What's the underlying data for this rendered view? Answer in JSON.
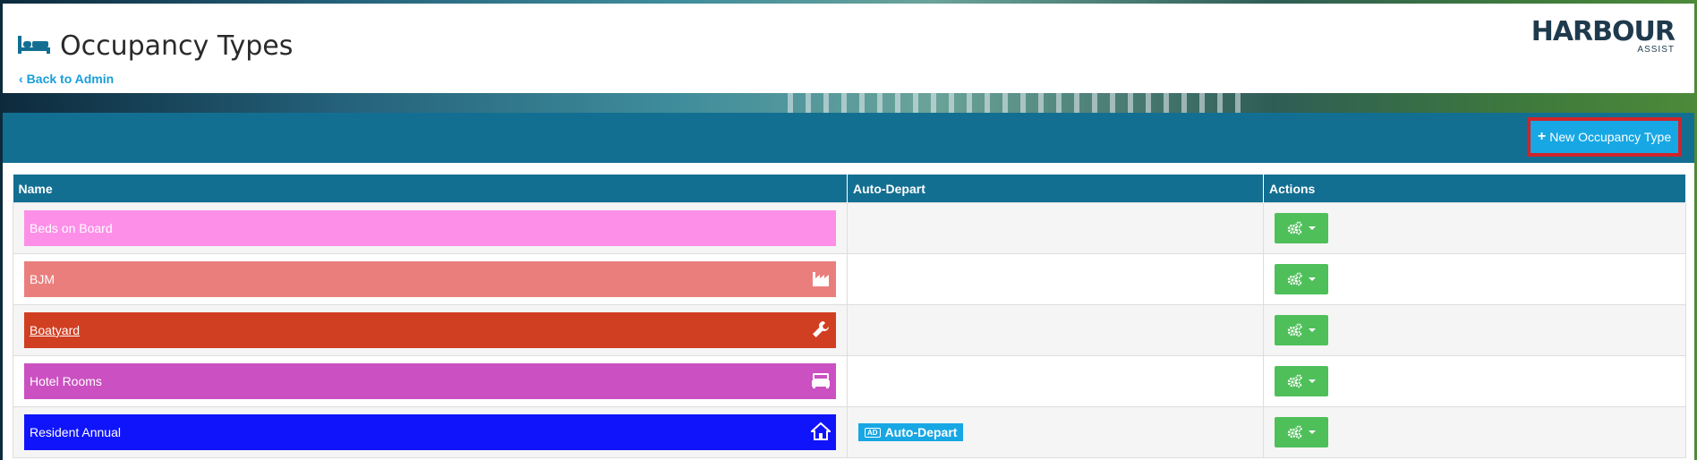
{
  "header": {
    "title": "Occupancy Types",
    "back_label": "Back to Admin",
    "logo_main": "HARBOUR",
    "logo_sub": "ASSIST"
  },
  "toolbar": {
    "new_label": "New Occupancy Type"
  },
  "table": {
    "columns": [
      "Name",
      "Auto-Depart",
      "Actions"
    ],
    "rows": [
      {
        "name": "Beds on Board",
        "color": "#fd8fe8",
        "icon": "",
        "underline": false,
        "auto_depart": ""
      },
      {
        "name": "BJM",
        "color": "#ea7e7d",
        "icon": "factory-icon",
        "underline": false,
        "auto_depart": ""
      },
      {
        "name": "Boatyard",
        "color": "#d13f22",
        "icon": "wrench-icon",
        "underline": true,
        "auto_depart": ""
      },
      {
        "name": "Hotel Rooms",
        "color": "#cb50c1",
        "icon": "bed-icon",
        "underline": false,
        "auto_depart": ""
      },
      {
        "name": "Resident Annual",
        "color": "#1014fb",
        "icon": "home-icon",
        "underline": false,
        "auto_depart": "Auto-Depart",
        "auto_depart_tag": "AD"
      }
    ]
  },
  "colors": {
    "header_bar": "#136f92",
    "primary": "#17a7e4",
    "action": "#4fbf5a",
    "highlight": "#d0232b"
  }
}
